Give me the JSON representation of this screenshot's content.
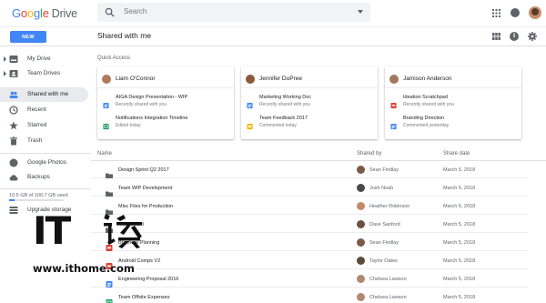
{
  "header": {
    "logo_word": "Google",
    "product": "Drive",
    "search_placeholder": "Search"
  },
  "toolbar": {
    "new_label": "NEW",
    "page_title": "Shared with me"
  },
  "sidebar": {
    "items": [
      {
        "label": "My Drive",
        "icon": "drive-icon"
      },
      {
        "label": "Team Drives",
        "icon": "team-drives-icon"
      },
      {
        "label": "Shared with me",
        "icon": "people-icon",
        "active": true
      },
      {
        "label": "Recent",
        "icon": "clock-icon"
      },
      {
        "label": "Starred",
        "icon": "star-icon"
      },
      {
        "label": "Trash",
        "icon": "trash-icon"
      },
      {
        "label": "Google Photos",
        "icon": "photos-icon"
      },
      {
        "label": "Backups",
        "icon": "cloud-icon"
      }
    ],
    "storage_text": "10.5 GB of 100.7 GB used",
    "storage_fraction": 0.104,
    "upgrade_label": "Upgrade storage"
  },
  "quick_access": {
    "label": "Quick Access",
    "cards": [
      {
        "user": "Liam O'Connor",
        "avatar_color": "#b07a5a",
        "files": [
          {
            "name": "AIGA Design Presentation - WIP",
            "sub": "Recently shared with you",
            "type": "docs",
            "color": "#4285f4"
          },
          {
            "name": "Notifications Integration Timeline",
            "sub": "Edited today",
            "type": "sheets",
            "color": "#0f9d58"
          }
        ]
      },
      {
        "user": "Jennifer DuPree",
        "avatar_color": "#8a5a3c",
        "files": [
          {
            "name": "Marketing Working Doc",
            "sub": "Recently shared with you",
            "type": "docs",
            "color": "#4285f4"
          },
          {
            "name": "Team Feedback 2017",
            "sub": "Commented today",
            "type": "slides",
            "color": "#f4b400"
          }
        ]
      },
      {
        "user": "Jamison Anderson",
        "avatar_color": "#a0785e",
        "files": [
          {
            "name": "Ideation Scratchpad",
            "sub": "Recently shared with you",
            "type": "pdf",
            "color": "#db4437"
          },
          {
            "name": "Branding Direction",
            "sub": "Commented yesterday",
            "type": "docs",
            "color": "#4285f4"
          }
        ]
      }
    ]
  },
  "list": {
    "headers": {
      "name": "Name",
      "owner": "Shared by",
      "date": "Share date"
    },
    "rows": [
      {
        "name": "Design Sprint Q2 2017",
        "owner": "Sean Findlay",
        "date": "March 5, 2018",
        "type": "folder",
        "color": "#5f6368",
        "avatar": "#7a5a48"
      },
      {
        "name": "Team WIP Development",
        "owner": "Josh Noah",
        "date": "March 5, 2018",
        "type": "folder",
        "color": "#5f6368",
        "avatar": "#4a4a4a"
      },
      {
        "name": "Misc Files for Production",
        "owner": "Heather Robinson",
        "date": "March 5, 2018",
        "type": "folder",
        "color": "#5f6368",
        "avatar": "#c48a6a"
      },
      {
        "name": "Moodboard",
        "owner": "Dave Sanford",
        "date": "March 5, 2018",
        "type": "folder",
        "color": "#5f6368",
        "avatar": "#6a5040"
      },
      {
        "name": "Brochure Planning",
        "owner": "Sean Findlay",
        "date": "March 5, 2018",
        "type": "pdf",
        "color": "#db4437",
        "avatar": "#7a5a48"
      },
      {
        "name": "Android Comps V2",
        "owner": "Taylor Oates",
        "date": "March 5, 2018",
        "type": "pdf",
        "color": "#db4437",
        "avatar": "#5a4a3a"
      },
      {
        "name": "Engineering Proposal 2016",
        "owner": "Chelsea Lawson",
        "date": "March 5, 2018",
        "type": "docs",
        "color": "#4285f4",
        "avatar": "#b08870"
      },
      {
        "name": "Team Offsite Expenses",
        "owner": "Chelsea Lawson",
        "date": "March 5, 2018",
        "type": "sheets",
        "color": "#0f9d58",
        "avatar": "#b08870"
      }
    ]
  },
  "watermark": {
    "brand": "IT",
    "brand_cn": "之家",
    "url": "www.ithome.com"
  }
}
